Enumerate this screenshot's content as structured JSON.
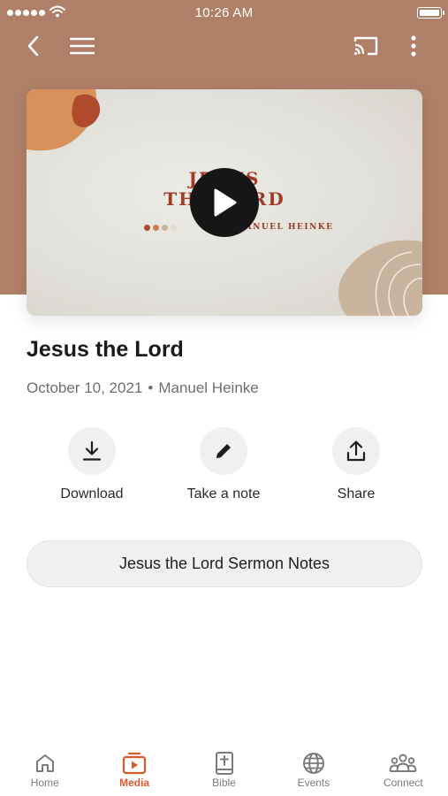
{
  "status_bar": {
    "time": "10:26 AM"
  },
  "colors": {
    "header_bg": "#b07f68",
    "accent": "#db5a2a",
    "thumbnail_text": "#a23a24"
  },
  "nav": {
    "back_icon": "chevron-left-icon",
    "menu_icon": "hamburger-menu-icon",
    "cast_icon": "cast-icon",
    "more_icon": "more-vertical-icon"
  },
  "video": {
    "thumbnail_title_line1": "JESUS",
    "thumbnail_title_line2": "THE LORD",
    "thumbnail_subtitle": "WITH MANUEL HEINKE",
    "play_icon": "play-icon"
  },
  "sermon": {
    "title": "Jesus the Lord",
    "date": "October 10, 2021",
    "separator": "•",
    "speaker": "Manuel Heinke"
  },
  "actions": [
    {
      "label": "Download",
      "icon": "download-icon"
    },
    {
      "label": "Take a note",
      "icon": "pencil-icon"
    },
    {
      "label": "Share",
      "icon": "share-icon"
    }
  ],
  "notes_button": {
    "label": "Jesus the Lord Sermon Notes"
  },
  "tabs": [
    {
      "label": "Home",
      "icon": "home-icon",
      "active": false
    },
    {
      "label": "Media",
      "icon": "media-play-icon",
      "active": true
    },
    {
      "label": "Bible",
      "icon": "bible-icon",
      "active": false
    },
    {
      "label": "Events",
      "icon": "globe-icon",
      "active": false
    },
    {
      "label": "Connect",
      "icon": "people-icon",
      "active": false
    }
  ]
}
